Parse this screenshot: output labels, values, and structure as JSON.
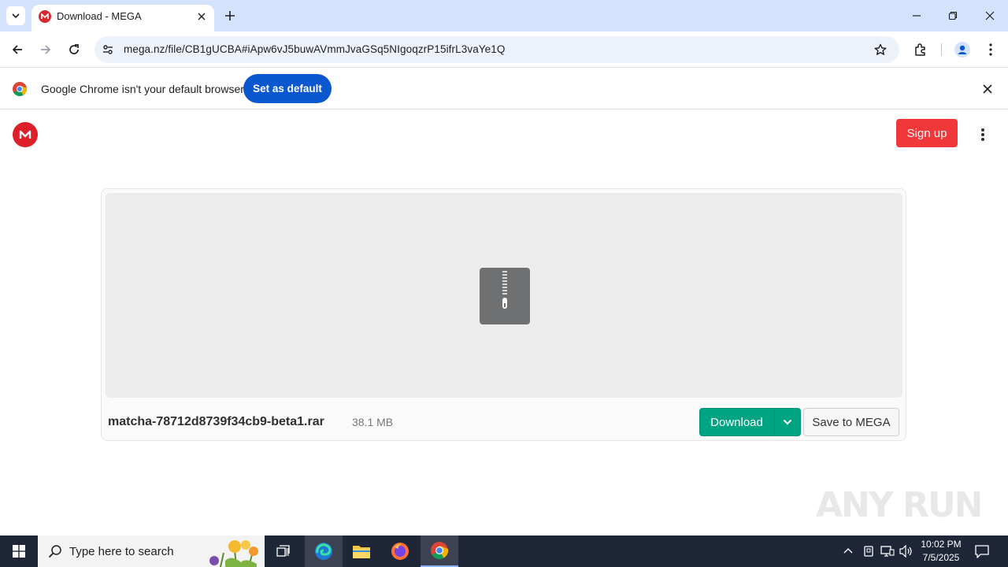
{
  "browser": {
    "tab_title": "Download - MEGA",
    "url": "mega.nz/file/CB1gUCBA#iApw6vJ5buwAVmmJvaGSq5NIgoqzrP15ifrL3vaYe1Q",
    "infobar_text": "Google Chrome isn't your default browser",
    "set_default_label": "Set as default"
  },
  "header": {
    "logo_letter": "M",
    "signup_label": "Sign up"
  },
  "file": {
    "name": "matcha-78712d8739f34cb9-beta1.rar",
    "size": "38.1 MB",
    "download_label": "Download",
    "save_label": "Save to MEGA"
  },
  "watermark": "ANY RUN",
  "taskbar": {
    "search_placeholder": "Type here to search",
    "time": "10:02 PM",
    "date": "7/5/2025"
  },
  "colors": {
    "mega_red": "#dd1f2a",
    "download_green": "#00a382",
    "chrome_blue": "#0b57d0",
    "tabstrip": "#d3e3fd"
  },
  "icons": [
    "tab-list-icon",
    "mega-favicon-icon",
    "close-icon",
    "plus-icon",
    "minimize-icon",
    "restore-icon",
    "back-icon",
    "forward-icon",
    "reload-icon",
    "site-info-icon",
    "star-icon",
    "extensions-icon",
    "profile-icon",
    "menu-icon",
    "chrome-logo-icon",
    "archive-icon",
    "chevron-down-icon",
    "windows-icon",
    "search-icon",
    "task-view-icon",
    "edge-icon",
    "file-explorer-icon",
    "firefox-icon",
    "chrome-icon",
    "tray-chevron-icon",
    "network-icon",
    "volume-icon",
    "notification-icon"
  ]
}
